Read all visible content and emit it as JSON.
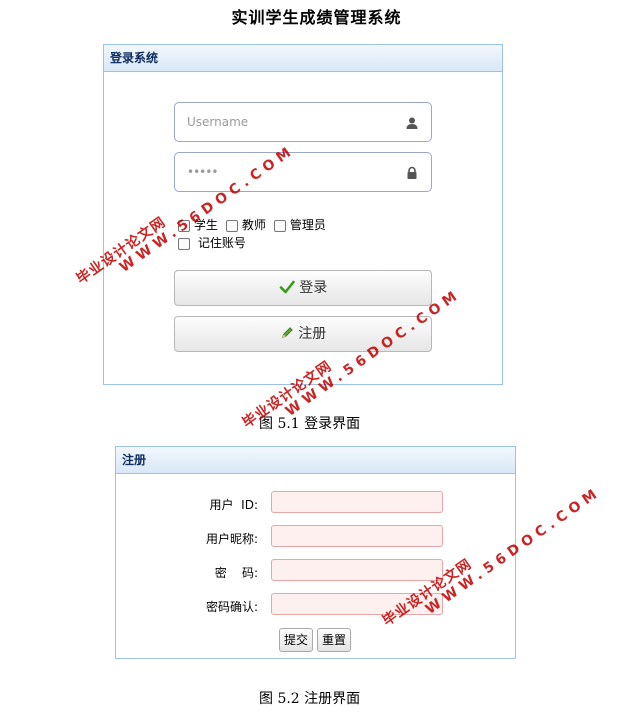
{
  "document": {
    "title": "实训学生成绩管理系统",
    "caption1": "图 5.1 登录界面",
    "caption2": "图 5.2 注册界面"
  },
  "login_panel": {
    "header": "登录系统",
    "username_placeholder": "Username",
    "password_placeholder": "•••••",
    "role_options": [
      "学生",
      "教师",
      "管理员"
    ],
    "remember_label": "记住账号",
    "login_button": "登录",
    "register_button": "注册",
    "icons": {
      "username": "user-icon",
      "password": "lock-icon",
      "login": "check-icon",
      "register": "pencil-icon"
    }
  },
  "register_panel": {
    "header": "注册",
    "fields": [
      {
        "label": "用户  ID:",
        "value": ""
      },
      {
        "label": "用户昵称:",
        "value": ""
      },
      {
        "label": "密    码:",
        "value": ""
      },
      {
        "label": "密码确认:",
        "value": ""
      }
    ],
    "submit_button": "提交",
    "reset_button": "重置"
  },
  "watermarks": [
    {
      "line1": "毕业设计论文网",
      "line2": "WWW.56DOC.COM"
    },
    {
      "line1": "毕业设计论文网",
      "line2": "WWW.56DOC.COM"
    },
    {
      "line1": "毕业设计论文网",
      "line2": "WWW.56DOC.COM"
    }
  ],
  "colors": {
    "panel_border": "#9cc2e6",
    "panel_header_text": "#0e2d5f",
    "input_invalid_bg": "#fff0f0",
    "input_invalid_border": "#e7a7a7",
    "watermark": "#c00000"
  }
}
